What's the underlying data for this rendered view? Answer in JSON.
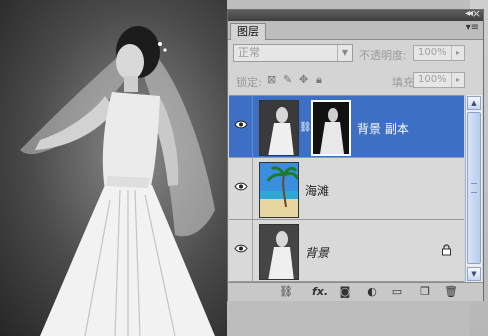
{
  "panel": {
    "tab_label": "图层",
    "blend_mode": "正常",
    "opacity_label": "不透明度:",
    "opacity_value": "100%",
    "lock_label": "锁定:",
    "fill_label": "填充:",
    "fill_value": "100%",
    "collapse_icon": "double-chevron-icon",
    "close_icon": "close-icon",
    "menu_icon": "panel-menu-icon"
  },
  "layers": [
    {
      "name": "背景 副本",
      "selected": true,
      "italic": false,
      "has_mask": true,
      "visible": true,
      "locked": false
    },
    {
      "name": "海滩",
      "selected": false,
      "italic": false,
      "has_mask": false,
      "visible": true,
      "locked": false
    },
    {
      "name": "背景",
      "selected": false,
      "italic": true,
      "has_mask": false,
      "visible": true,
      "locked": true
    }
  ],
  "toolbar": {
    "tools": [
      "link-layers-icon",
      "fx-icon",
      "add-mask-icon",
      "adjustment-layer-icon",
      "new-group-icon",
      "new-layer-icon",
      "trash-icon"
    ],
    "fx_label": "fx."
  },
  "colors": {
    "selection": "#3d6fc4",
    "panel_bg": "#d4d4d4",
    "titlebar": "#4a4a4a"
  }
}
